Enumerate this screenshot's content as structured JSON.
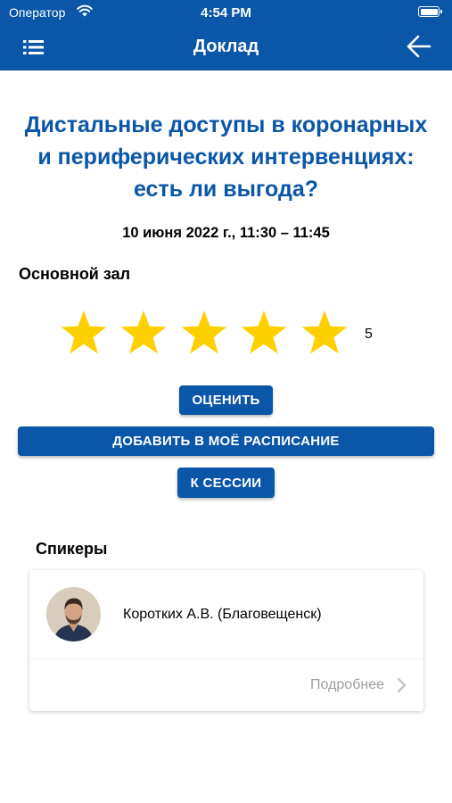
{
  "status_bar": {
    "carrier": "Оператор",
    "time": "4:54 PM",
    "wifi_icon": "wifi-icon",
    "battery_icon": "battery-icon"
  },
  "nav": {
    "title": "Доклад",
    "menu_icon": "list-menu-icon",
    "back_icon": "arrow-left-icon"
  },
  "talk": {
    "title": "Дистальные доступы в коронарных и периферических интервенциях: есть ли выгода?",
    "datetime": "10 июня 2022 г., 11:30 – 11:45",
    "hall": "Основной зал"
  },
  "rating": {
    "filled_stars": 5,
    "max_stars": 5,
    "value": "5",
    "star_color": "#FFD000"
  },
  "buttons": {
    "rate": "ОЦЕНИТЬ",
    "add_schedule": "ДОБАВИТЬ В МОЁ РАСПИСАНИЕ",
    "to_session": "К СЕССИИ"
  },
  "speakers": {
    "heading": "Спикеры",
    "items": [
      {
        "name": "Коротких А.В. (Благовещенск)",
        "more_label": "Подробнее"
      }
    ]
  },
  "colors": {
    "primary": "#0A56A8",
    "header_text": "#FFFFFF",
    "muted_text": "#9E9E9E"
  }
}
